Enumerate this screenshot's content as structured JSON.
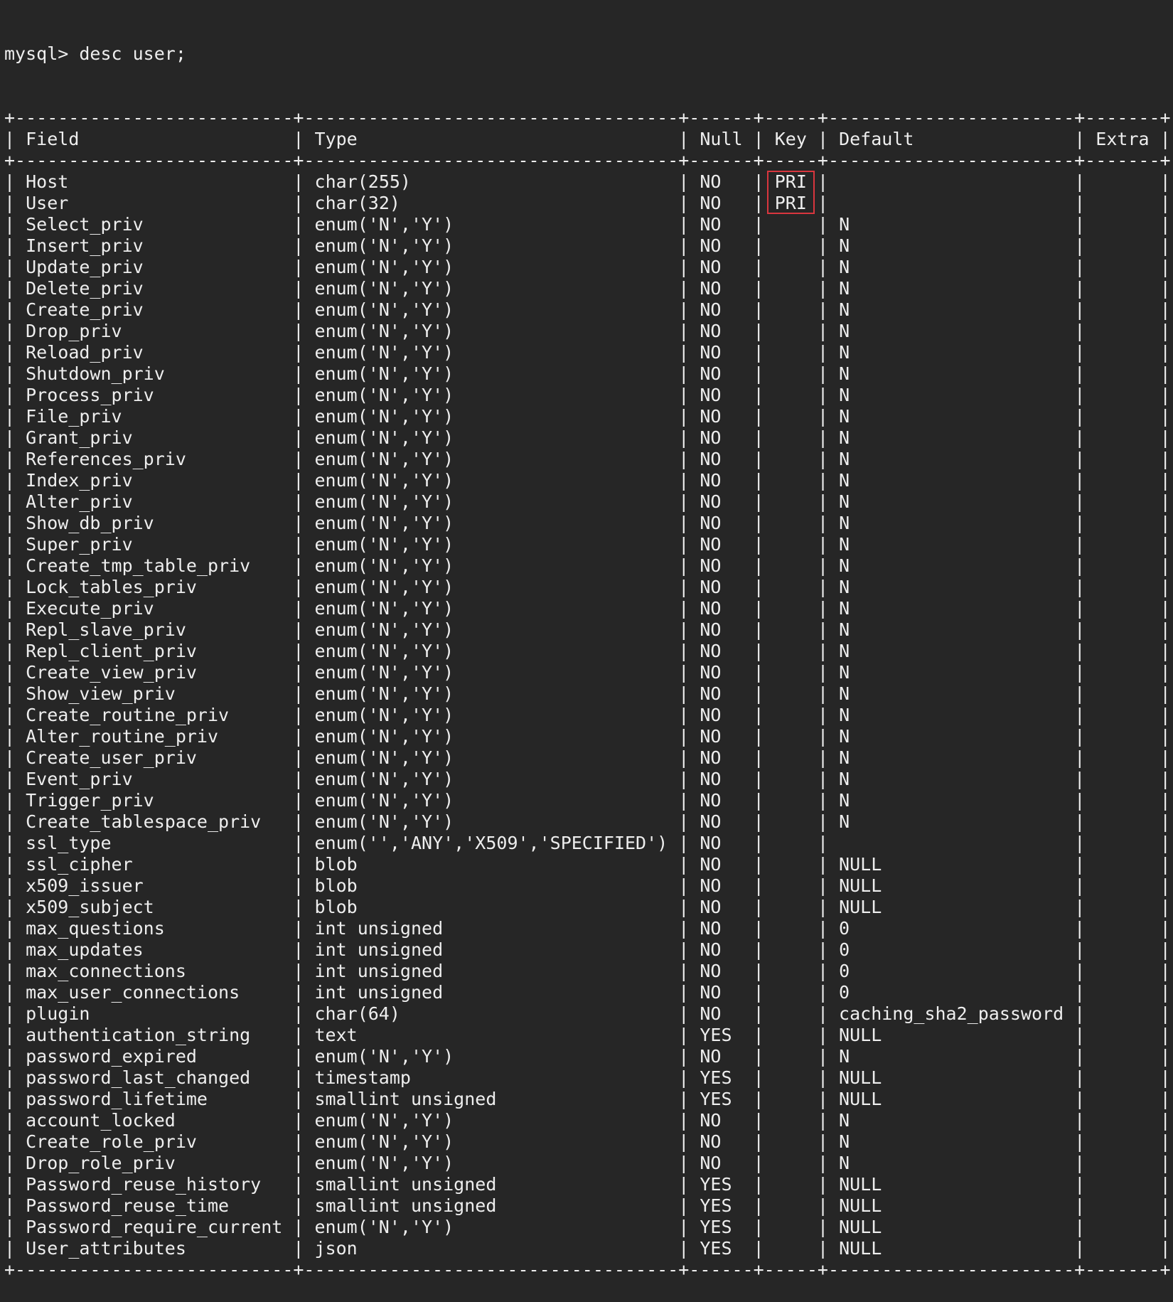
{
  "prompt": "mysql> desc user;",
  "columns": [
    "Field",
    "Type",
    "Null",
    "Key",
    "Default",
    "Extra"
  ],
  "rows": [
    [
      "Host",
      "char(255)",
      "NO",
      "PRI",
      "",
      ""
    ],
    [
      "User",
      "char(32)",
      "NO",
      "PRI",
      "",
      ""
    ],
    [
      "Select_priv",
      "enum('N','Y')",
      "NO",
      "",
      "N",
      ""
    ],
    [
      "Insert_priv",
      "enum('N','Y')",
      "NO",
      "",
      "N",
      ""
    ],
    [
      "Update_priv",
      "enum('N','Y')",
      "NO",
      "",
      "N",
      ""
    ],
    [
      "Delete_priv",
      "enum('N','Y')",
      "NO",
      "",
      "N",
      ""
    ],
    [
      "Create_priv",
      "enum('N','Y')",
      "NO",
      "",
      "N",
      ""
    ],
    [
      "Drop_priv",
      "enum('N','Y')",
      "NO",
      "",
      "N",
      ""
    ],
    [
      "Reload_priv",
      "enum('N','Y')",
      "NO",
      "",
      "N",
      ""
    ],
    [
      "Shutdown_priv",
      "enum('N','Y')",
      "NO",
      "",
      "N",
      ""
    ],
    [
      "Process_priv",
      "enum('N','Y')",
      "NO",
      "",
      "N",
      ""
    ],
    [
      "File_priv",
      "enum('N','Y')",
      "NO",
      "",
      "N",
      ""
    ],
    [
      "Grant_priv",
      "enum('N','Y')",
      "NO",
      "",
      "N",
      ""
    ],
    [
      "References_priv",
      "enum('N','Y')",
      "NO",
      "",
      "N",
      ""
    ],
    [
      "Index_priv",
      "enum('N','Y')",
      "NO",
      "",
      "N",
      ""
    ],
    [
      "Alter_priv",
      "enum('N','Y')",
      "NO",
      "",
      "N",
      ""
    ],
    [
      "Show_db_priv",
      "enum('N','Y')",
      "NO",
      "",
      "N",
      ""
    ],
    [
      "Super_priv",
      "enum('N','Y')",
      "NO",
      "",
      "N",
      ""
    ],
    [
      "Create_tmp_table_priv",
      "enum('N','Y')",
      "NO",
      "",
      "N",
      ""
    ],
    [
      "Lock_tables_priv",
      "enum('N','Y')",
      "NO",
      "",
      "N",
      ""
    ],
    [
      "Execute_priv",
      "enum('N','Y')",
      "NO",
      "",
      "N",
      ""
    ],
    [
      "Repl_slave_priv",
      "enum('N','Y')",
      "NO",
      "",
      "N",
      ""
    ],
    [
      "Repl_client_priv",
      "enum('N','Y')",
      "NO",
      "",
      "N",
      ""
    ],
    [
      "Create_view_priv",
      "enum('N','Y')",
      "NO",
      "",
      "N",
      ""
    ],
    [
      "Show_view_priv",
      "enum('N','Y')",
      "NO",
      "",
      "N",
      ""
    ],
    [
      "Create_routine_priv",
      "enum('N','Y')",
      "NO",
      "",
      "N",
      ""
    ],
    [
      "Alter_routine_priv",
      "enum('N','Y')",
      "NO",
      "",
      "N",
      ""
    ],
    [
      "Create_user_priv",
      "enum('N','Y')",
      "NO",
      "",
      "N",
      ""
    ],
    [
      "Event_priv",
      "enum('N','Y')",
      "NO",
      "",
      "N",
      ""
    ],
    [
      "Trigger_priv",
      "enum('N','Y')",
      "NO",
      "",
      "N",
      ""
    ],
    [
      "Create_tablespace_priv",
      "enum('N','Y')",
      "NO",
      "",
      "N",
      ""
    ],
    [
      "ssl_type",
      "enum('','ANY','X509','SPECIFIED')",
      "NO",
      "",
      "",
      ""
    ],
    [
      "ssl_cipher",
      "blob",
      "NO",
      "",
      "NULL",
      ""
    ],
    [
      "x509_issuer",
      "blob",
      "NO",
      "",
      "NULL",
      ""
    ],
    [
      "x509_subject",
      "blob",
      "NO",
      "",
      "NULL",
      ""
    ],
    [
      "max_questions",
      "int unsigned",
      "NO",
      "",
      "0",
      ""
    ],
    [
      "max_updates",
      "int unsigned",
      "NO",
      "",
      "0",
      ""
    ],
    [
      "max_connections",
      "int unsigned",
      "NO",
      "",
      "0",
      ""
    ],
    [
      "max_user_connections",
      "int unsigned",
      "NO",
      "",
      "0",
      ""
    ],
    [
      "plugin",
      "char(64)",
      "NO",
      "",
      "caching_sha2_password",
      ""
    ],
    [
      "authentication_string",
      "text",
      "YES",
      "",
      "NULL",
      ""
    ],
    [
      "password_expired",
      "enum('N','Y')",
      "NO",
      "",
      "N",
      ""
    ],
    [
      "password_last_changed",
      "timestamp",
      "YES",
      "",
      "NULL",
      ""
    ],
    [
      "password_lifetime",
      "smallint unsigned",
      "YES",
      "",
      "NULL",
      ""
    ],
    [
      "account_locked",
      "enum('N','Y')",
      "NO",
      "",
      "N",
      ""
    ],
    [
      "Create_role_priv",
      "enum('N','Y')",
      "NO",
      "",
      "N",
      ""
    ],
    [
      "Drop_role_priv",
      "enum('N','Y')",
      "NO",
      "",
      "N",
      ""
    ],
    [
      "Password_reuse_history",
      "smallint unsigned",
      "YES",
      "",
      "NULL",
      ""
    ],
    [
      "Password_reuse_time",
      "smallint unsigned",
      "YES",
      "",
      "NULL",
      ""
    ],
    [
      "Password_require_current",
      "enum('N','Y')",
      "YES",
      "",
      "NULL",
      ""
    ],
    [
      "User_attributes",
      "json",
      "YES",
      "",
      "NULL",
      ""
    ]
  ],
  "colors": {
    "background": "#262626",
    "text": "#eeeeee",
    "highlight_box": "#d9363e"
  }
}
